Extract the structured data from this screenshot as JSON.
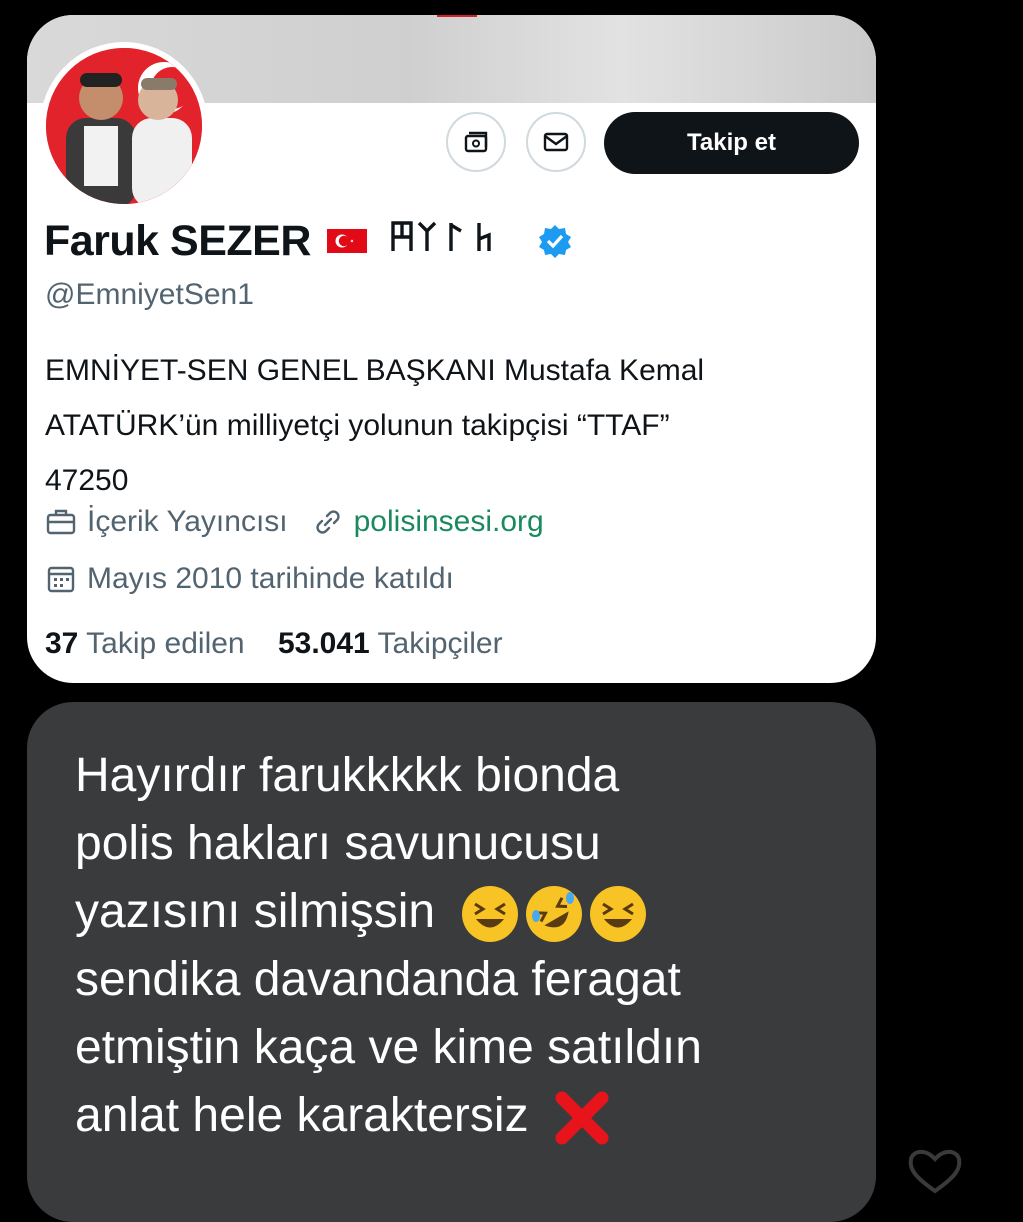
{
  "profile": {
    "name": "Faruk SEZER",
    "runes": "𐰉𐰚𐰺𐰴",
    "handle": "@EmniyetSen1",
    "bio_lines": [
      "EMNİYET-SEN GENEL BAŞKANI Mustafa Kemal",
      "ATATÜRK’ün milliyetçi yolunun takipçisi “TTAF”",
      "47250"
    ],
    "category": "İçerik Yayıncısı",
    "website": "polisinsesi.org",
    "joined": "Mayıs 2010 tarihinde katıldı",
    "following_count": "37",
    "following_label": "Takip edilen",
    "followers_count": "53.041",
    "followers_label": "Takipçiler",
    "follow_button": "Takip et"
  },
  "message": {
    "lines": [
      "Hayırdır farukkkkk bionda",
      "polis hakları savunucusu",
      "yazısını silmişsin",
      "sendika davandanda feragat",
      "etmiştin kaça ve kime satıldın",
      "anlat hele karaktersiz"
    ]
  },
  "colors": {
    "background": "#000000",
    "card": "#ffffff",
    "bubble": "#3a3b3d",
    "follow_button": "#0f1419",
    "link": "#1a8a5e",
    "verified": "#1d9bf0"
  },
  "icons": [
    "subscribe-icon",
    "envelope-icon",
    "verified-icon",
    "briefcase-icon",
    "link-icon",
    "calendar-icon",
    "squint-laugh-emoji",
    "rofl-emoji",
    "cross-mark-emoji",
    "heart-icon"
  ]
}
